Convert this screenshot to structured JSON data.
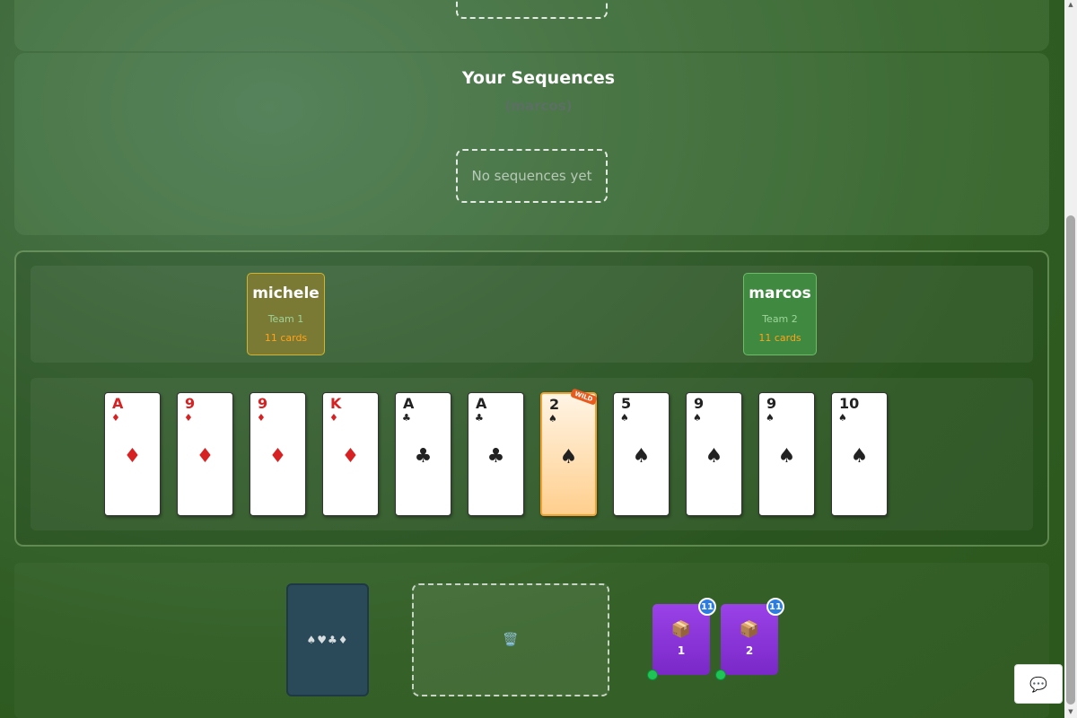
{
  "sequences": {
    "title": "Your Sequences",
    "owner": "(marcos)",
    "empty_text": "No sequences yet"
  },
  "players": [
    {
      "name": "michele",
      "team": "Team 1",
      "cards": "11 cards"
    },
    {
      "name": "marcos",
      "team": "Team 2",
      "cards": "11 cards"
    }
  ],
  "hand": [
    {
      "rank": "A",
      "suit": "♦",
      "color": "red"
    },
    {
      "rank": "9",
      "suit": "♦",
      "color": "red"
    },
    {
      "rank": "9",
      "suit": "♦",
      "color": "red"
    },
    {
      "rank": "K",
      "suit": "♦",
      "color": "red"
    },
    {
      "rank": "A",
      "suit": "♣",
      "color": "black"
    },
    {
      "rank": "A",
      "suit": "♣",
      "color": "black"
    },
    {
      "rank": "2",
      "suit": "♠",
      "color": "black",
      "wild": true,
      "tag": "WILD"
    },
    {
      "rank": "5",
      "suit": "♠",
      "color": "black"
    },
    {
      "rank": "9",
      "suit": "♠",
      "color": "black"
    },
    {
      "rank": "9",
      "suit": "♠",
      "color": "black"
    },
    {
      "rank": "10",
      "suit": "♠",
      "color": "black"
    }
  ],
  "deck": {
    "label": "♠♥♣♦"
  },
  "discard": {
    "icon": "🗑️"
  },
  "piles": [
    {
      "icon": "📦",
      "label": "1",
      "count": "11"
    },
    {
      "icon": "📦",
      "label": "2",
      "count": "11"
    }
  ],
  "chat": {
    "icon": "💬"
  },
  "colors": {
    "table_green": "#2f5c22",
    "team1": "#7a7a34",
    "team2": "#3f8a40",
    "wild_border": "#f2a030",
    "pile_purple": "#9a42e8",
    "count_blue": "#2d7de0",
    "status_green": "#1fc456"
  }
}
